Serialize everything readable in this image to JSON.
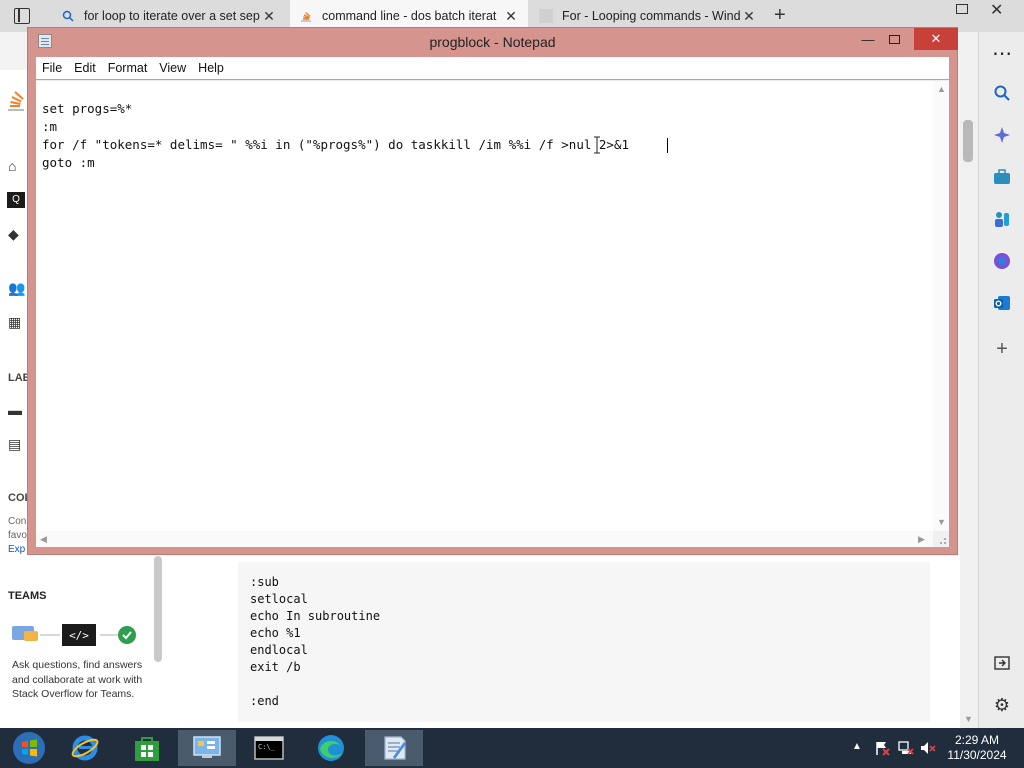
{
  "browser": {
    "tabs": [
      {
        "title": "for loop to iterate over a set sepa",
        "icon": "search-icon",
        "active": false
      },
      {
        "title": "command line - dos batch iterat",
        "icon": "stackoverflow-icon",
        "active": true
      },
      {
        "title": "For - Looping commands - Wind",
        "icon": "page-icon",
        "active": false
      }
    ],
    "new_tab_glyph": "+",
    "more_glyph": "⋯"
  },
  "notepad": {
    "title": "progblock - Notepad",
    "menu": [
      "File",
      "Edit",
      "Format",
      "View",
      "Help"
    ],
    "lines": [
      "",
      "set progs=%*",
      ":m",
      "for /f \"tokens=* delims= \" %%i in (\"%progs%\") do taskkill /im %%i /f >nul 2>&1",
      "goto :m"
    ]
  },
  "page": {
    "left_nav": {
      "label_labs": "LAB",
      "label_col": "COL",
      "col_lines": [
        "Con",
        "favo",
        "Exp"
      ],
      "teams_heading": "TEAMS",
      "teams_text": "Ask questions, find answers and collaborate at work with Stack Overflow for Teams."
    },
    "code_lines": [
      ":sub",
      "setlocal",
      "echo In subroutine",
      "echo %1",
      "endlocal",
      "exit /b",
      "",
      ":end"
    ]
  },
  "taskbar": {
    "time": "2:29 AM",
    "date": "11/30/2024",
    "apps": [
      "start-button",
      "internet-explorer",
      "store",
      "control-panel",
      "command-prompt",
      "edge",
      "notepad"
    ]
  },
  "colors": {
    "notepad_frame": "#d6948f",
    "close_button": "#c7413a",
    "taskbar": "#1f2d3d"
  }
}
